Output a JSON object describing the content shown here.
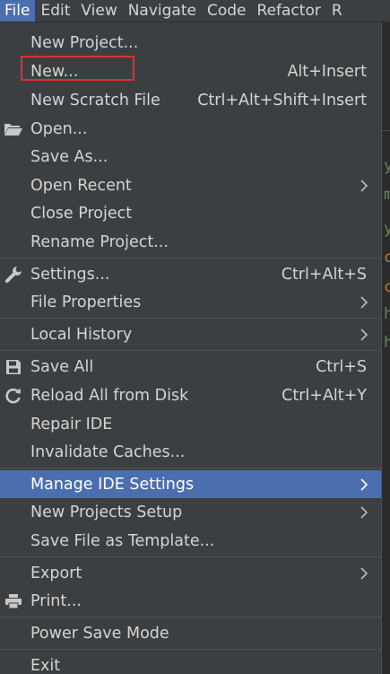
{
  "menubar": {
    "items": [
      "File",
      "Edit",
      "View",
      "Navigate",
      "Code",
      "Refactor",
      "R"
    ]
  },
  "file_menu": {
    "items": [
      {
        "label": "New Project...",
        "shortcut": "",
        "submenu": false,
        "icon": ""
      },
      {
        "label": "New...",
        "shortcut": "Alt+Insert",
        "submenu": false,
        "icon": "",
        "annotated": true
      },
      {
        "label": "New Scratch File",
        "shortcut": "Ctrl+Alt+Shift+Insert",
        "submenu": false,
        "icon": ""
      },
      {
        "label": "Open...",
        "shortcut": "",
        "submenu": false,
        "icon": "folder-open-icon"
      },
      {
        "label": "Save As...",
        "shortcut": "",
        "submenu": false,
        "icon": ""
      },
      {
        "label": "Open Recent",
        "shortcut": "",
        "submenu": true,
        "icon": ""
      },
      {
        "label": "Close Project",
        "shortcut": "",
        "submenu": false,
        "icon": ""
      },
      {
        "label": "Rename Project...",
        "shortcut": "",
        "submenu": false,
        "icon": ""
      },
      {
        "label": "Settings...",
        "shortcut": "Ctrl+Alt+S",
        "submenu": false,
        "icon": "wrench-icon"
      },
      {
        "label": "File Properties",
        "shortcut": "",
        "submenu": true,
        "icon": ""
      },
      {
        "label": "Local History",
        "shortcut": "",
        "submenu": true,
        "icon": ""
      },
      {
        "label": "Save All",
        "shortcut": "Ctrl+S",
        "submenu": false,
        "icon": "floppy-disk-icon"
      },
      {
        "label": "Reload All from Disk",
        "shortcut": "Ctrl+Alt+Y",
        "submenu": false,
        "icon": "reload-icon"
      },
      {
        "label": "Repair IDE",
        "shortcut": "",
        "submenu": false,
        "icon": ""
      },
      {
        "label": "Invalidate Caches...",
        "shortcut": "",
        "submenu": false,
        "icon": ""
      },
      {
        "label": "Manage IDE Settings",
        "shortcut": "",
        "submenu": true,
        "icon": "",
        "highlighted": true
      },
      {
        "label": "New Projects Setup",
        "shortcut": "",
        "submenu": true,
        "icon": ""
      },
      {
        "label": "Save File as Template...",
        "shortcut": "",
        "submenu": false,
        "icon": ""
      },
      {
        "label": "Export",
        "shortcut": "",
        "submenu": true,
        "icon": ""
      },
      {
        "label": "Print...",
        "shortcut": "",
        "submenu": false,
        "icon": "printer-icon"
      },
      {
        "label": "Power Save Mode",
        "shortcut": "",
        "submenu": false,
        "icon": ""
      },
      {
        "label": "Exit",
        "shortcut": "",
        "submenu": false,
        "icon": ""
      }
    ]
  },
  "colors": {
    "menu_bg": "#3c3f41",
    "highlight": "#4b6eaf",
    "annotation_box": "#e0312f",
    "text": "#d4d4d4"
  },
  "editor_glimpse": [
    "y",
    "m",
    "y",
    "c",
    "c",
    "h",
    "h"
  ]
}
